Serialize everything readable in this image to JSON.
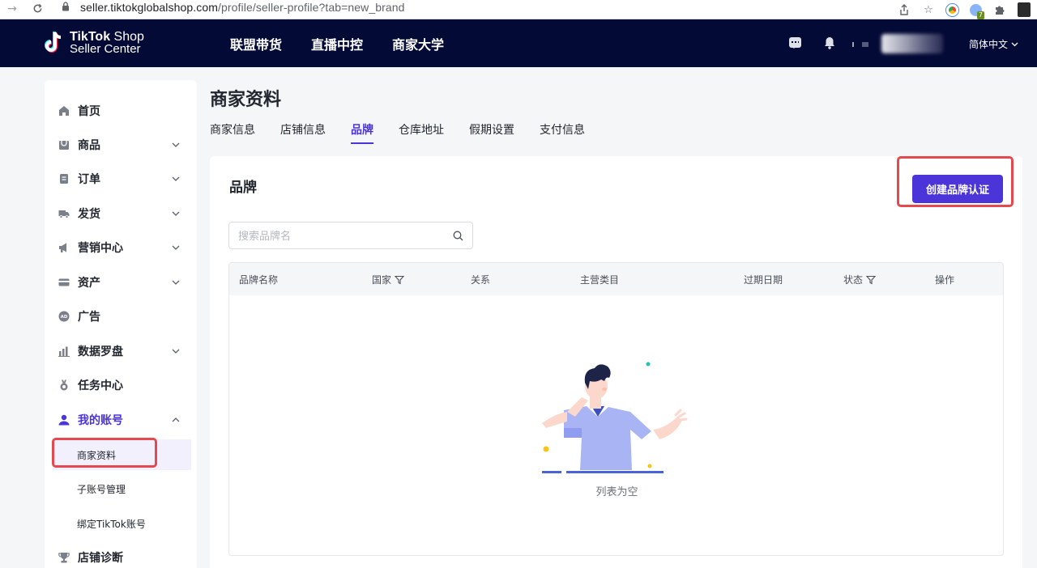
{
  "browser": {
    "url_host": "seller.tiktokglobalshop.com",
    "url_path": "/profile/seller-profile?tab=new_brand",
    "ext_badge": "7"
  },
  "header": {
    "logo_line1": "TikTok",
    "logo_line1b": " Shop",
    "logo_line2": "Seller Center",
    "nav": [
      "联盟带货",
      "直播中控",
      "商家大学"
    ],
    "language": "简体中文"
  },
  "sidebar": {
    "items": [
      {
        "label": "首页",
        "icon": "home-icon"
      },
      {
        "label": "商品",
        "icon": "product-icon"
      },
      {
        "label": "订单",
        "icon": "order-icon"
      },
      {
        "label": "发货",
        "icon": "truck-icon"
      },
      {
        "label": "营销中心",
        "icon": "megaphone-icon"
      },
      {
        "label": "资产",
        "icon": "card-icon"
      },
      {
        "label": "广告",
        "icon": "ad-icon"
      },
      {
        "label": "数据罗盘",
        "icon": "chart-icon"
      },
      {
        "label": "任务中心",
        "icon": "medal-icon"
      },
      {
        "label": "我的账号",
        "icon": "user-icon"
      }
    ],
    "sub_items": [
      "商家资料",
      "子账号管理",
      "绑定TikTok账号"
    ],
    "last_item": {
      "label": "店铺诊断",
      "icon": "trophy-icon"
    }
  },
  "main": {
    "title": "商家资料",
    "tabs": [
      "商家信息",
      "店铺信息",
      "品牌",
      "仓库地址",
      "假期设置",
      "支付信息"
    ],
    "active_tab": "品牌"
  },
  "brand_card": {
    "title": "品牌",
    "create_button": "创建品牌认证",
    "search_placeholder": "搜索品牌名",
    "columns": [
      "品牌名称",
      "国家",
      "关系",
      "主营类目",
      "过期日期",
      "状态",
      "操作"
    ],
    "empty_text": "列表为空"
  },
  "colors": {
    "accent": "#4b35d9",
    "header_bg": "#040a36",
    "highlight_border": "#e5484d"
  }
}
